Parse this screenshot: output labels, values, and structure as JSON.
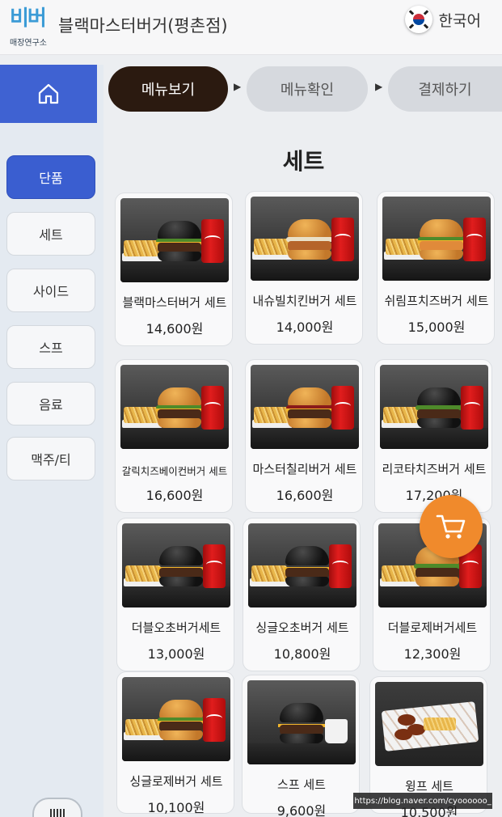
{
  "header": {
    "logo_mark": "비버",
    "logo_sub": "매장연구소",
    "store_name": "블랙마스터버거(평촌점)",
    "language": "한국어"
  },
  "steps": [
    {
      "label": "메뉴보기",
      "active": true
    },
    {
      "label": "메뉴확인",
      "active": false
    },
    {
      "label": "결제하기",
      "active": false
    }
  ],
  "sidebar": {
    "categories": [
      {
        "label": "단품",
        "active": true
      },
      {
        "label": "세트",
        "active": false
      },
      {
        "label": "사이드",
        "active": false
      },
      {
        "label": "스프",
        "active": false
      },
      {
        "label": "음료",
        "active": false
      },
      {
        "label": "맥주/티",
        "active": false
      }
    ]
  },
  "section_title": "세트",
  "products": [
    {
      "name": "블랙마스터버거 세트",
      "price": "14,600원"
    },
    {
      "name": "내슈빌치킨버거 세트",
      "price": "14,000원"
    },
    {
      "name": "쉬림프치즈버거 세트",
      "price": "15,000원"
    },
    {
      "name": "갈릭치즈베이컨버거 세트",
      "price": "16,600원"
    },
    {
      "name": "마스터칠리버거 세트",
      "price": "16,600원"
    },
    {
      "name": "리코타치즈버거 세트",
      "price": "17,200원"
    },
    {
      "name": "더블오초버거세트",
      "price": "13,000원"
    },
    {
      "name": "싱글오초버거 세트",
      "price": "10,800원"
    },
    {
      "name": "더블로제버거세트",
      "price": "12,300원"
    },
    {
      "name": "싱글로제버거 세트",
      "price": "10,100원"
    },
    {
      "name": "스프 세트",
      "price": "9,600원"
    },
    {
      "name": "윙프 세트",
      "price": "10,500원"
    }
  ],
  "watermark": "https://blog.naver.com/cyoooooo_",
  "colors": {
    "accent_blue": "#3f62d2",
    "step_active": "#2b1a10",
    "cart_orange": "#f08a2c"
  }
}
